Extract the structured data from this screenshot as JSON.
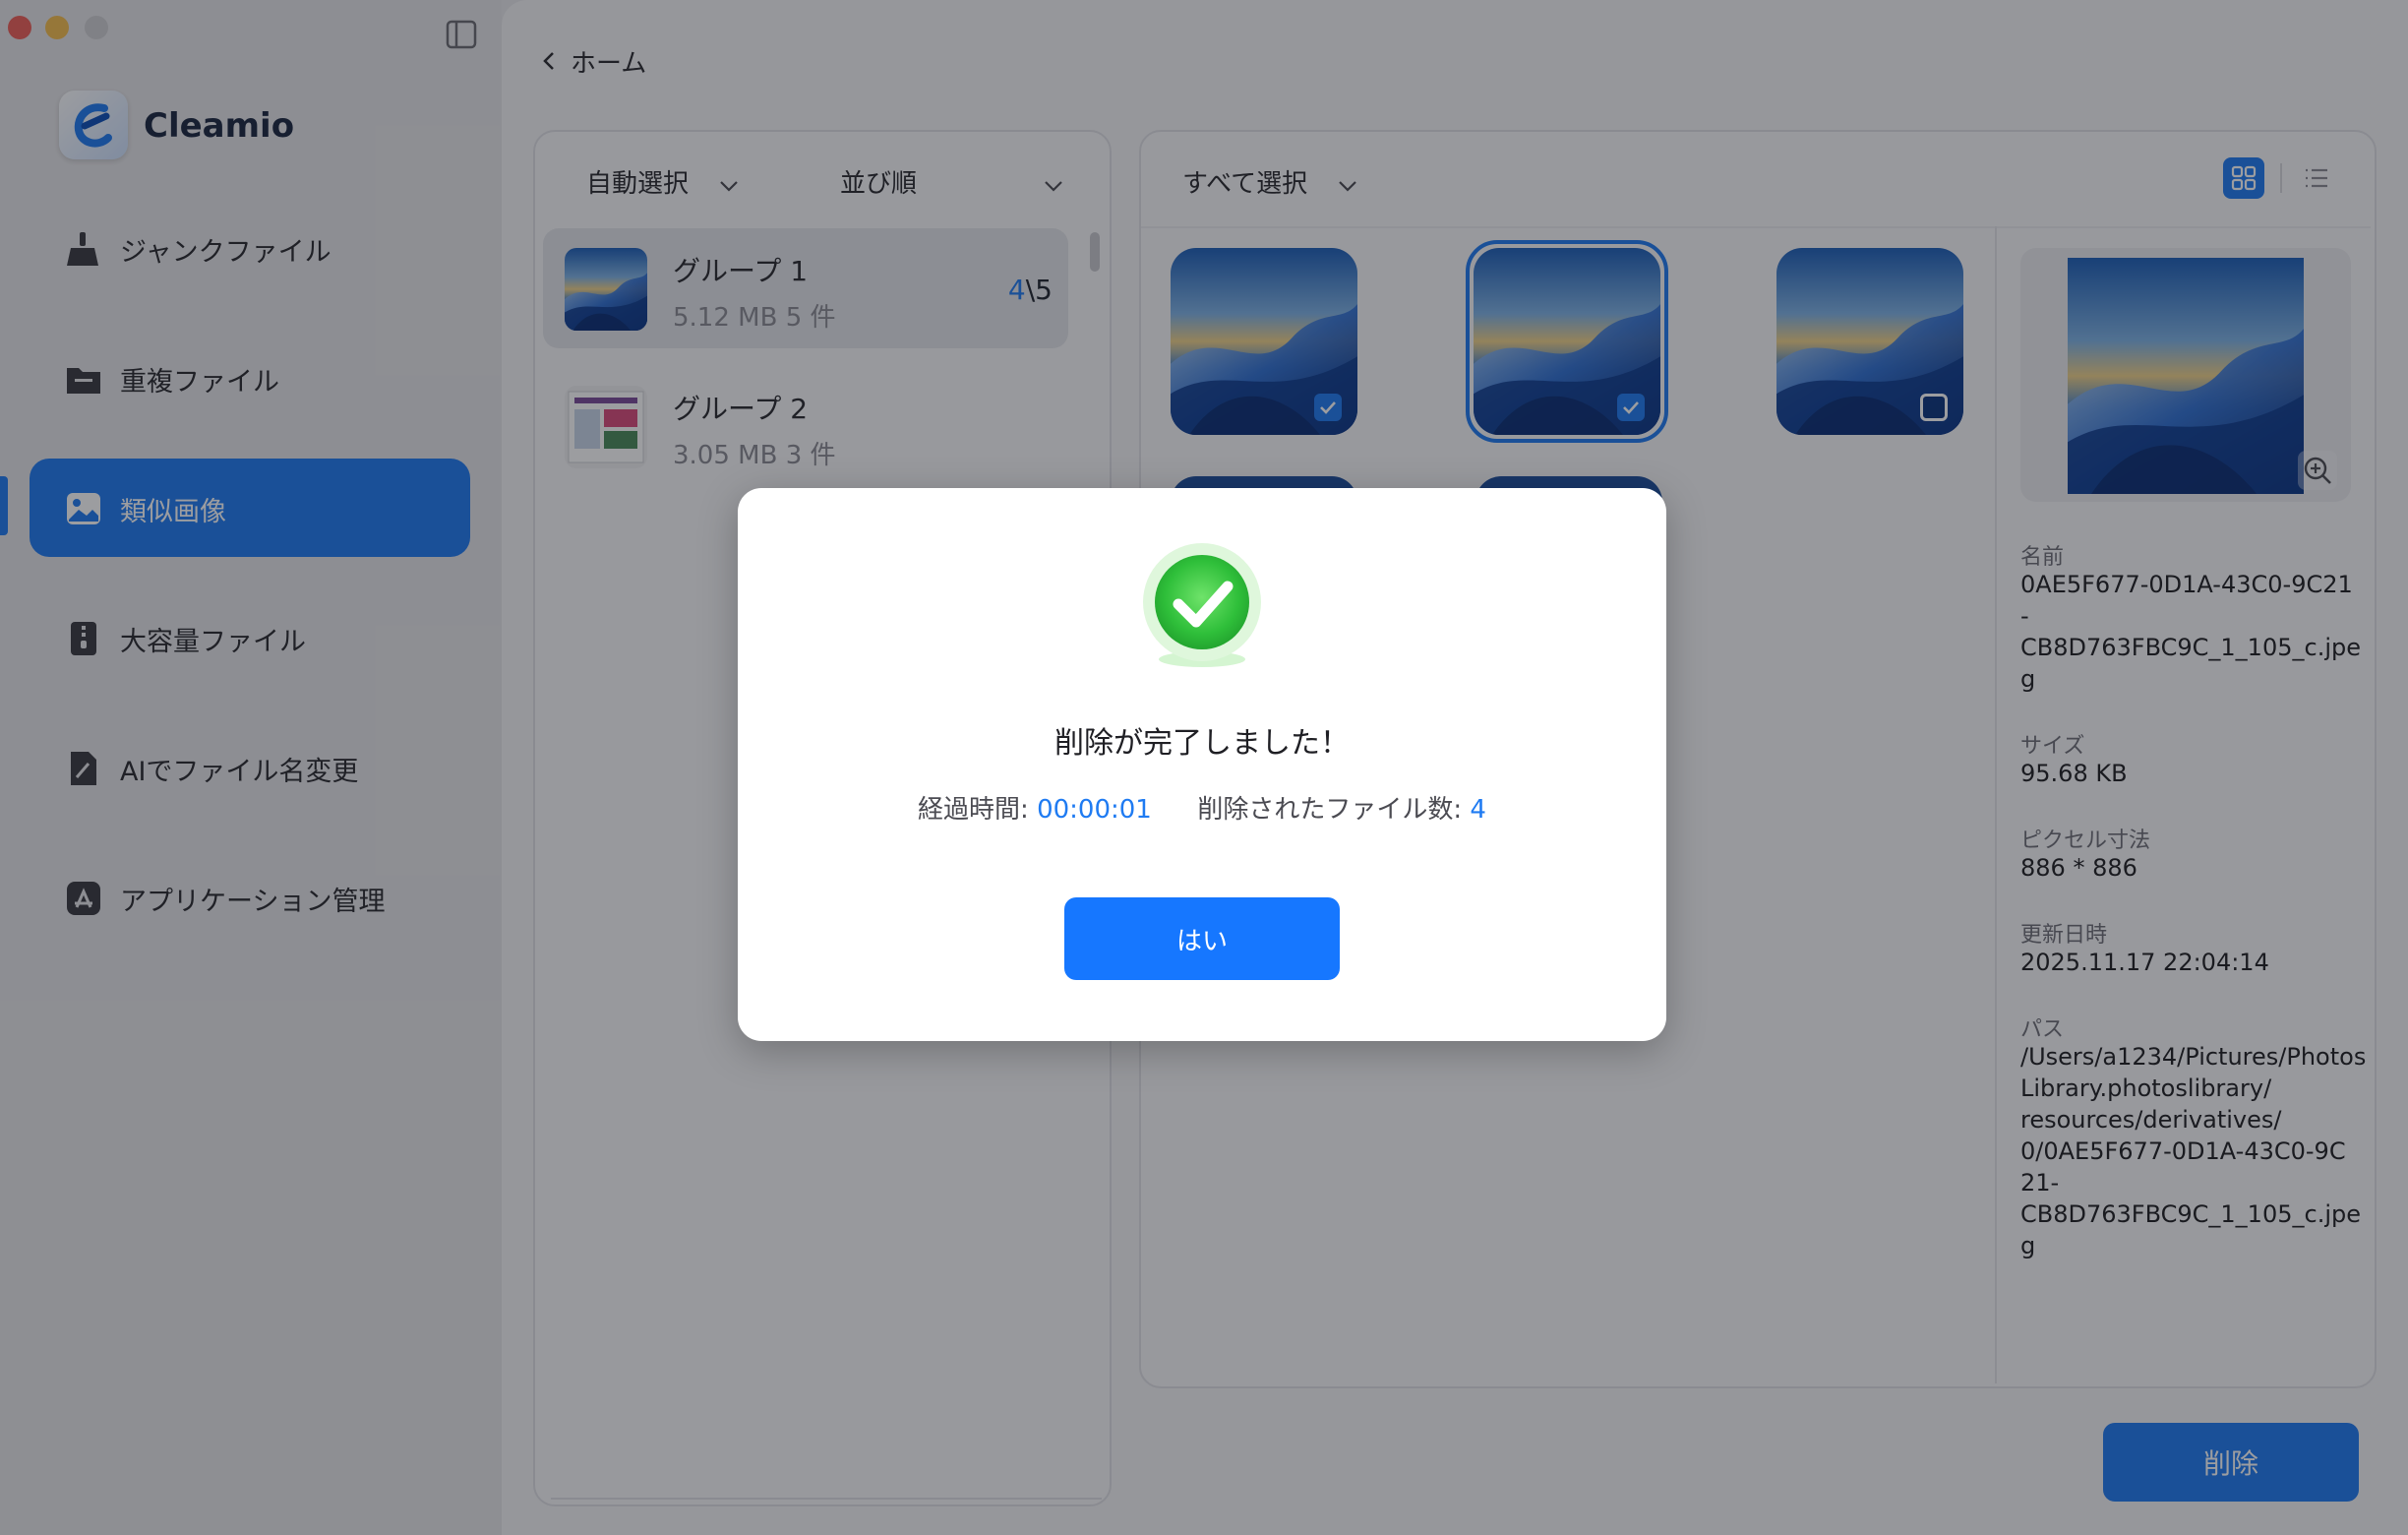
{
  "app": {
    "name": "Cleamio"
  },
  "sidebar": {
    "items": [
      {
        "label": "ジャンクファイル",
        "icon": "broom-icon"
      },
      {
        "label": "重複ファイル",
        "icon": "folder-icon"
      },
      {
        "label": "類似画像",
        "icon": "image-icon",
        "active": true
      },
      {
        "label": "大容量ファイル",
        "icon": "zip-file-icon"
      },
      {
        "label": "AIでファイル名変更",
        "icon": "pen-file-icon"
      },
      {
        "label": "アプリケーション管理",
        "icon": "app-store-icon"
      }
    ]
  },
  "header": {
    "back_label": "ホーム"
  },
  "groups_panel": {
    "auto_select_label": "自動選択",
    "sort_label": "並び順",
    "groups": [
      {
        "title": "グループ 1",
        "meta": "5.12  MB  5 件",
        "selected": "4",
        "total": "5"
      },
      {
        "title": "グループ 2",
        "meta": "3.05  MB  3 件"
      }
    ]
  },
  "images_panel": {
    "select_all_label": "すべて選択",
    "thumbnails": [
      {
        "checked": true,
        "highlighted": false
      },
      {
        "checked": true,
        "highlighted": true
      },
      {
        "checked": false,
        "highlighted": false
      }
    ],
    "details": {
      "name_label": "名前",
      "name_value": "0AE5F677-0D1A-43C0-9C21\n-\nCB8D763FBC9C_1_105_c.jpe\ng",
      "size_label": "サイズ",
      "size_value": "95.68  KB",
      "pixels_label": "ピクセル寸法",
      "pixels_value": "886 * 886",
      "modified_label": "更新日時",
      "modified_value": "2025.11.17 22:04:14",
      "path_label": "パス",
      "path_value": "/Users/a1234/Pictures/Photos\nLibrary.photoslibrary/\nresources/derivatives/\n0/0AE5F677-0D1A-43C0-9C\n21-\nCB8D763FBC9C_1_105_c.jpe\ng"
    },
    "delete_label": "削除"
  },
  "dialog": {
    "title": "削除が完了しました！",
    "elapsed_label": "経過時間:",
    "elapsed_value": "00:00:01",
    "deleted_label": "削除されたファイル数:",
    "deleted_value": "4",
    "ok_label": "はい"
  },
  "colors": {
    "accent": "#1f7bf2",
    "success": "#34c759"
  }
}
